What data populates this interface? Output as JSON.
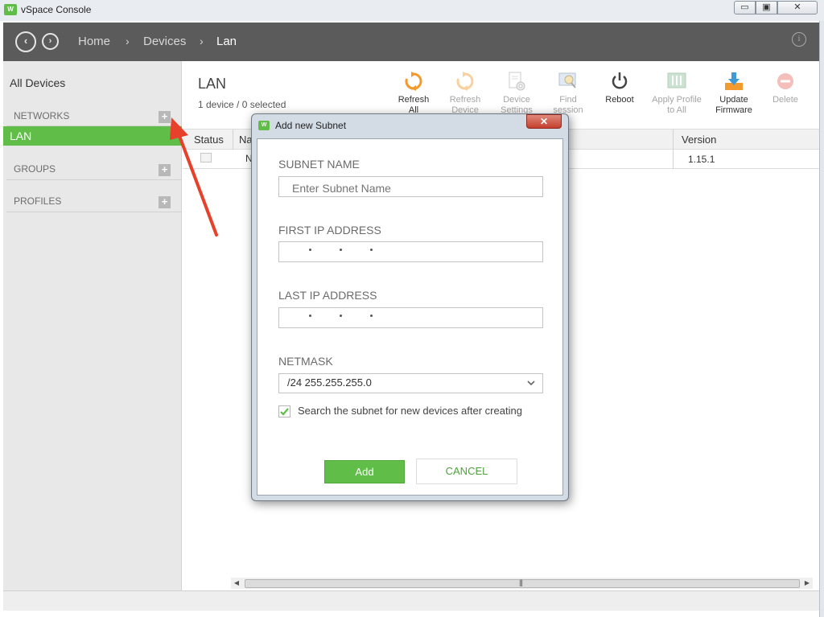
{
  "window": {
    "title": "vSpace Console",
    "logo_text": "W",
    "min_glyph": "▭",
    "max_glyph": "▣",
    "close_glyph": "✕"
  },
  "header": {
    "back_glyph": "‹",
    "forward_glyph": "›",
    "breadcrumb": [
      "Home",
      "Devices",
      "Lan"
    ],
    "separator": "›",
    "info_glyph": "i"
  },
  "sidebar": {
    "all_devices": "All Devices",
    "networks_label": "NETWORKS",
    "active_network": "LAN",
    "groups_label": "GROUPS",
    "profiles_label": "PROFILES",
    "add_glyph": "+"
  },
  "main": {
    "title": "LAN",
    "subtitle": "1 device / 0 selected"
  },
  "toolbar": {
    "refresh_all": [
      "Refresh",
      "All"
    ],
    "refresh_device": [
      "Refresh",
      "Device"
    ],
    "device_settings": [
      "Device",
      "Settings"
    ],
    "find_session": [
      "Find",
      "session"
    ],
    "reboot": [
      "Reboot",
      ""
    ],
    "apply_profile": [
      "Apply Profile",
      "to All"
    ],
    "update_firmware": [
      "Update",
      "Firmware"
    ],
    "delete": [
      "Delete",
      ""
    ]
  },
  "grid": {
    "columns": {
      "status": "Status",
      "name": "Na",
      "version": "Version"
    },
    "rows": [
      {
        "name": "N",
        "version": "1.15.1"
      }
    ]
  },
  "scroll": {
    "left_glyph": "◀",
    "right_glyph": "▶",
    "grip": "|||"
  },
  "dialog": {
    "title": "Add new Subnet",
    "close_glyph": "✕",
    "subnet_name_label": "SUBNET NAME",
    "subnet_name_placeholder": "Enter Subnet Name",
    "first_ip_label": "FIRST IP ADDRESS",
    "last_ip_label": "LAST IP ADDRESS",
    "netmask_label": "NETMASK",
    "netmask_value": "/24 255.255.255.0",
    "search_checkbox_label": "Search the subnet for new devices after creating",
    "search_checked": true,
    "add_label": "Add",
    "cancel_label": "CANCEL"
  },
  "colors": {
    "accent_green": "#5fbd48",
    "header_bg": "#5b5b5b",
    "sidebar_bg": "#e8e8e8",
    "arrow_red": "#e8412b",
    "refresh_orange": "#f29a2e",
    "firmware_blue": "#3e9bd6"
  }
}
